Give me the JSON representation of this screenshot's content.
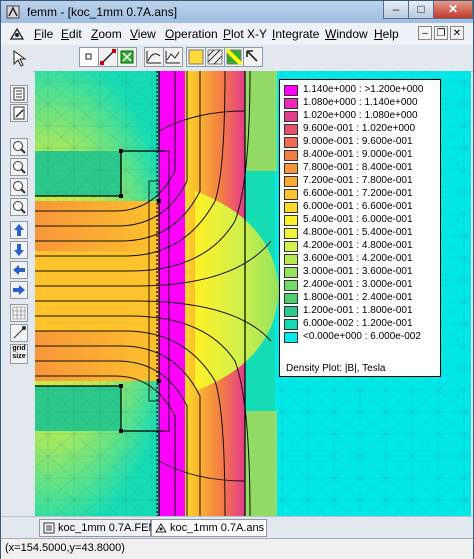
{
  "window": {
    "title": "femm - [koc_1mm 0.7A.ans]",
    "minimize_glyph": "–",
    "maximize_glyph": "□",
    "close_glyph": "✕"
  },
  "menubar": {
    "items": [
      {
        "ul": "F",
        "rest": "ile"
      },
      {
        "ul": "E",
        "rest": "dit"
      },
      {
        "ul": "Z",
        "rest": "oom"
      },
      {
        "ul": "V",
        "rest": "iew"
      },
      {
        "ul": "O",
        "rest": "peration"
      },
      {
        "ul": "P",
        "rest": "lot X-Y"
      },
      {
        "ul": "I",
        "rest": "ntegrate"
      },
      {
        "ul": "W",
        "rest": "indow"
      },
      {
        "ul": "H",
        "rest": "elp"
      }
    ],
    "mdi_minimize": "–",
    "mdi_restore": "❐",
    "mdi_close": "✕"
  },
  "legend": {
    "rows": [
      {
        "label": "1.140e+000 : >1.200e+000",
        "color": "#ff00ff"
      },
      {
        "label": "1.080e+000 : 1.140e+000",
        "color": "#ee2bb8"
      },
      {
        "label": "1.020e+000 : 1.080e+000",
        "color": "#e33b8e"
      },
      {
        "label": "9.600e-001 : 1.020e+000",
        "color": "#e5506a"
      },
      {
        "label": "9.000e-001 : 9.600e-001",
        "color": "#ee6a52"
      },
      {
        "label": "8.400e-001 : 9.000e-001",
        "color": "#f47d44"
      },
      {
        "label": "7.800e-001 : 8.400e-001",
        "color": "#f8963b"
      },
      {
        "label": "7.200e-001 : 7.800e-001",
        "color": "#fbab33"
      },
      {
        "label": "6.600e-001 : 7.200e-001",
        "color": "#fdc22c"
      },
      {
        "label": "6.000e-001 : 6.600e-001",
        "color": "#fed927"
      },
      {
        "label": "5.400e-001 : 6.000e-001",
        "color": "#fff126"
      },
      {
        "label": "4.800e-001 : 5.400e-001",
        "color": "#eef53a"
      },
      {
        "label": "4.200e-001 : 4.800e-001",
        "color": "#d4f04a"
      },
      {
        "label": "3.600e-001 : 4.200e-001",
        "color": "#b6ea55"
      },
      {
        "label": "3.000e-001 : 3.600e-001",
        "color": "#95e25e"
      },
      {
        "label": "2.400e-001 : 3.000e-001",
        "color": "#72da66"
      },
      {
        "label": "1.800e-001 : 2.400e-001",
        "color": "#4cd06e"
      },
      {
        "label": "1.200e-001 : 1.800e-001",
        "color": "#2cc98a"
      },
      {
        "label": "6.000e-002 : 1.200e-001",
        "color": "#16dcb4"
      },
      {
        "label": "<0.000e+000 : 6.000e-002",
        "color": "#00ecec"
      }
    ],
    "caption": "Density Plot: |B|, Tesla"
  },
  "tabs": [
    {
      "label": "koc_1mm 0.7A.FEM",
      "active": false
    },
    {
      "label": "koc_1mm 0.7A.ans",
      "active": true
    }
  ],
  "sidebar": {
    "zoom_label_top": "grid",
    "zoom_label_bottom": "size"
  },
  "status": {
    "text": "(x=154.5000,y=43.8000)"
  }
}
